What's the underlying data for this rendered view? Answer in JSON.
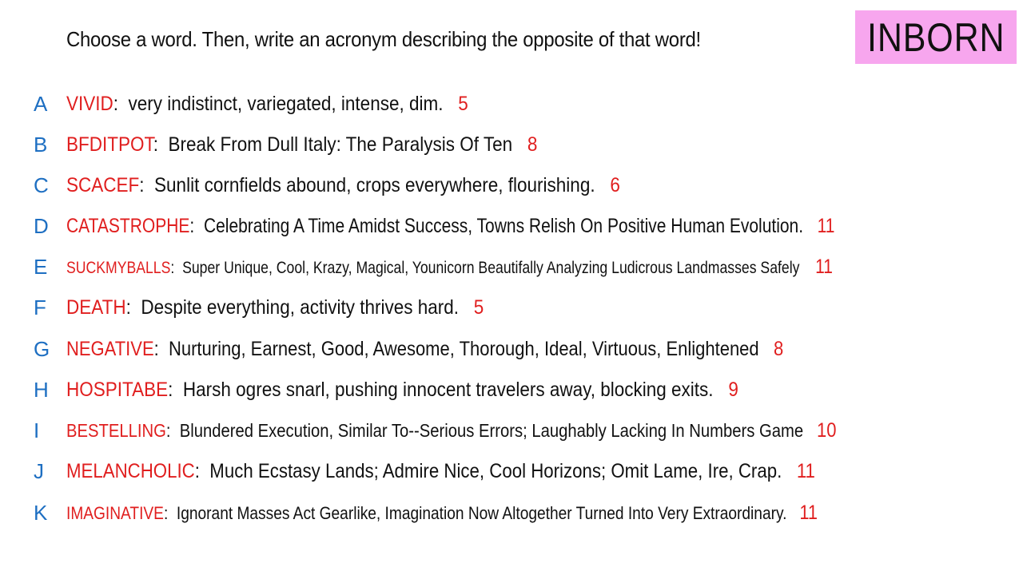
{
  "prompt": "Choose a word. Then, write an acronym describing the opposite of that word!",
  "badge": {
    "text": "INBORN",
    "color": "#f7a6ee"
  },
  "colors": {
    "letter": "#1e6fc2",
    "word": "#e01e1e",
    "count": "#e01e1e",
    "text": "#111111"
  },
  "entries": [
    {
      "letter": "A",
      "word": "VIVID",
      "colon": ":",
      "description": "very indistinct, variegated, intense, dim.",
      "count": "5"
    },
    {
      "letter": "B",
      "word": "BFDITPOT",
      "colon": ":",
      "description": "Break From Dull Italy: The Paralysis Of Ten",
      "count": "8"
    },
    {
      "letter": "C",
      "word": "SCACEF",
      "colon": ":",
      "description": "Sunlit cornfields abound, crops everywhere, flourishing.",
      "count": "6"
    },
    {
      "letter": "D",
      "word": "CATASTROPHE",
      "colon": ":",
      "description": "Celebrating A Time Amidst Success, Towns Relish On Positive Human Evolution.",
      "count": "11"
    },
    {
      "letter": "E",
      "word": "SUCKMYBALLS",
      "colon": ":",
      "description": "Super Unique, Cool, Krazy, Magical, Younicorn Beautifally Analyzing Ludicrous Landmasses Safely",
      "count": "11"
    },
    {
      "letter": "F",
      "word": "DEATH",
      "colon": ":",
      "description": "Despite everything, activity thrives hard.",
      "count": "5"
    },
    {
      "letter": "G",
      "word": "NEGATIVE",
      "colon": ":",
      "description": "Nurturing, Earnest, Good, Awesome, Thorough, Ideal, Virtuous, Enlightened",
      "count": "8"
    },
    {
      "letter": "H",
      "word": "HOSPITABE",
      "colon": ":",
      "description": "Harsh ogres snarl, pushing innocent travelers away, blocking exits.",
      "count": "9"
    },
    {
      "letter": "I",
      "word": "BESTELLING",
      "colon": ":",
      "description": "Blundered Execution, Similar To--Serious Errors; Laughably Lacking In Numbers Game",
      "count": "10"
    },
    {
      "letter": "J",
      "word": "MELANCHOLIC",
      "colon": ":",
      "description": "Much Ecstasy Lands; Admire Nice, Cool Horizons; Omit Lame, Ire, Crap.",
      "count": "11"
    },
    {
      "letter": "K",
      "word": "IMAGINATIVE",
      "colon": ":",
      "description": "Ignorant Masses Act Gearlike, Imagination Now Altogether Turned Into Very Extraordinary.",
      "count": "11"
    }
  ]
}
